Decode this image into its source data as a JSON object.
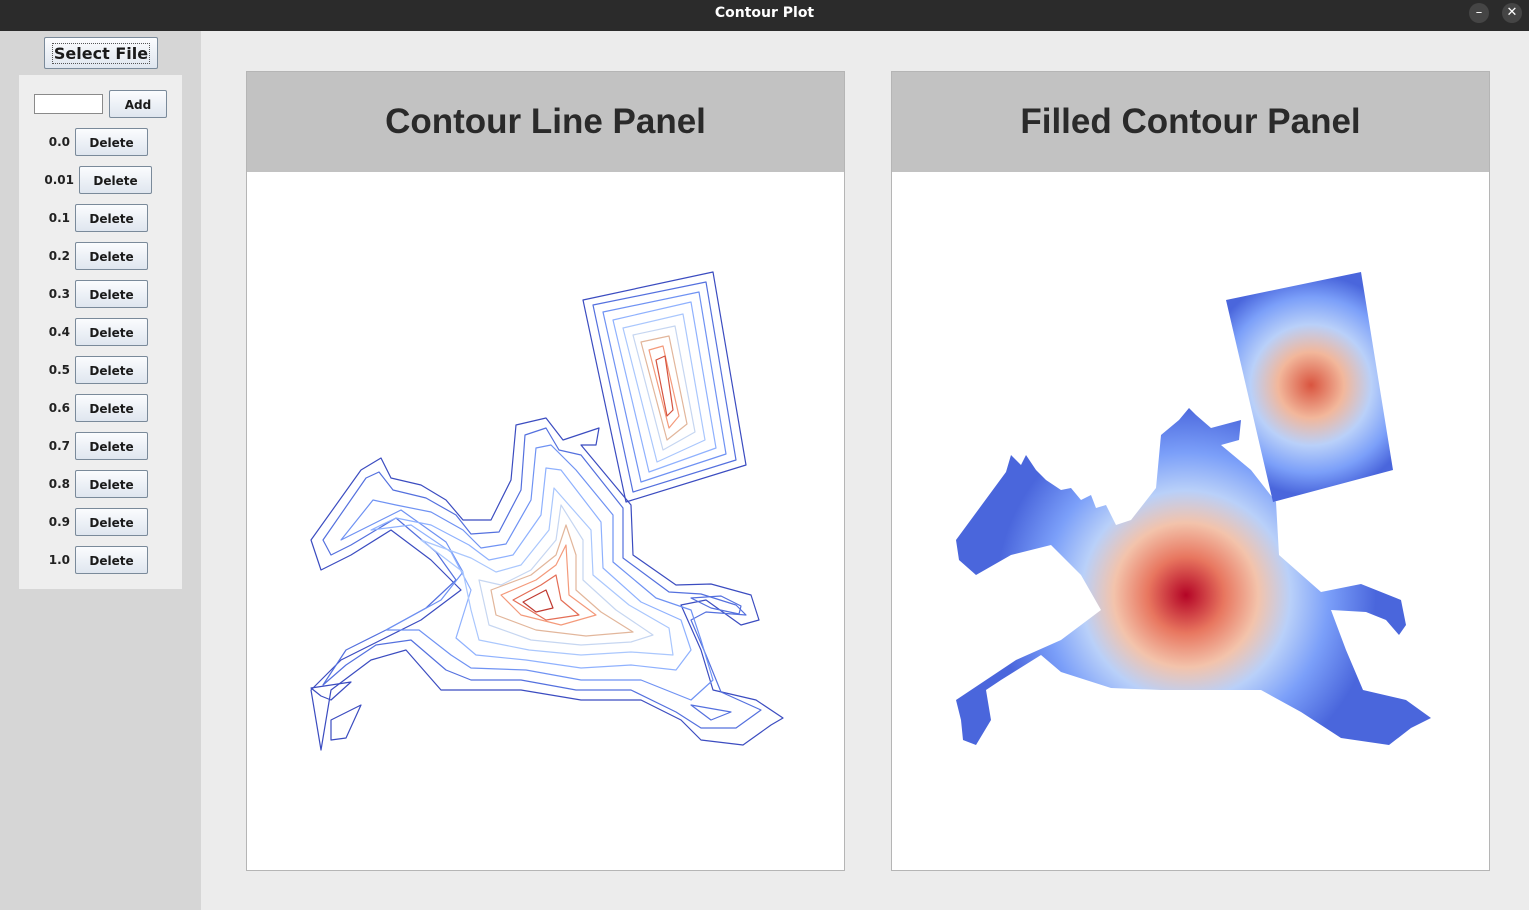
{
  "window": {
    "title": "Contour Plot",
    "minimize_glyph": "–",
    "close_glyph": "✕"
  },
  "sidebar": {
    "select_file_label": "Select File",
    "level_input_value": "",
    "add_label": "Add",
    "delete_label": "Delete",
    "levels": [
      "0.0",
      "0.01",
      "0.1",
      "0.2",
      "0.3",
      "0.4",
      "0.5",
      "0.6",
      "0.7",
      "0.8",
      "0.9",
      "1.0"
    ]
  },
  "panels": {
    "contour_line_title": "Contour Line Panel",
    "filled_contour_title": "Filled Contour Panel"
  },
  "colors": {
    "low": "#3b4cc0",
    "mid": "#dddddd",
    "high": "#b40426"
  }
}
